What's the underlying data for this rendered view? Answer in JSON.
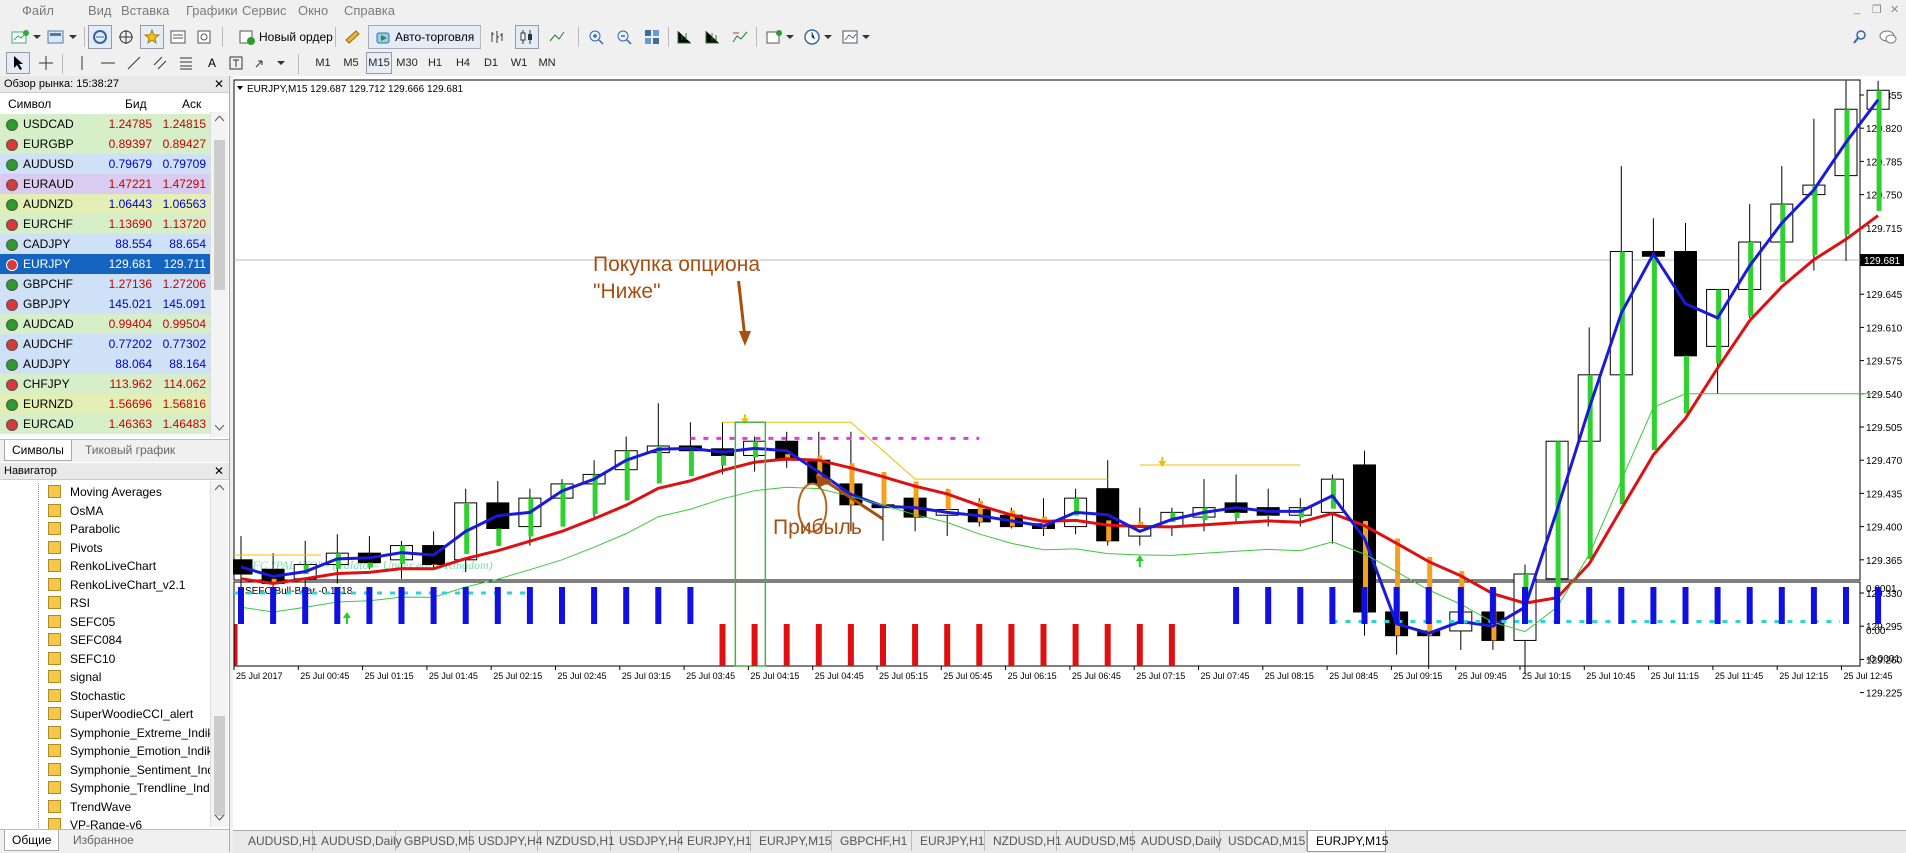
{
  "menu": [
    "Файл",
    "Вид",
    "Вставка",
    "Графики",
    "Сервис",
    "Окно",
    "Справка"
  ],
  "toolbar": {
    "new_order": "Новый ордер",
    "autotrading": "Авто-торговля",
    "timeframes": [
      "M1",
      "M5",
      "M15",
      "M30",
      "H1",
      "H4",
      "D1",
      "W1",
      "MN"
    ],
    "active_timeframe": "M15"
  },
  "market_watch": {
    "title": "Обзор рынка: 15:38:27",
    "col_symbol": "Символ",
    "col_bid": "Бид",
    "col_ask": "Аск",
    "rows": [
      {
        "symbol": "USDCAD",
        "bid": "1.24785",
        "ask": "1.24815",
        "bg": "#d7efc9",
        "color": "#cc0000"
      },
      {
        "symbol": "EURGBP",
        "bid": "0.89397",
        "ask": "0.89427",
        "bg": "#d7efc9",
        "color": "#cc0000"
      },
      {
        "symbol": "AUDUSD",
        "bid": "0.79679",
        "ask": "0.79709",
        "bg": "#cfe1f7",
        "color": "#0000cc"
      },
      {
        "symbol": "EURAUD",
        "bid": "1.47221",
        "ask": "1.47291",
        "bg": "#d9ccf0",
        "color": "#cc0000"
      },
      {
        "symbol": "AUDNZD",
        "bid": "1.06443",
        "ask": "1.06563",
        "bg": "#e3efb5",
        "color": "#0000cc"
      },
      {
        "symbol": "EURCHF",
        "bid": "1.13690",
        "ask": "1.13720",
        "bg": "#d7efc9",
        "color": "#cc0000"
      },
      {
        "symbol": "CADJPY",
        "bid": "88.554",
        "ask": "88.654",
        "bg": "#cfe1f7",
        "color": "#0000cc"
      },
      {
        "symbol": "EURJPY",
        "bid": "129.681",
        "ask": "129.711",
        "bg": "#1565c0",
        "color": "#ffffff"
      },
      {
        "symbol": "GBPCHF",
        "bid": "1.27136",
        "ask": "1.27206",
        "bg": "#cfe1f7",
        "color": "#cc0000"
      },
      {
        "symbol": "GBPJPY",
        "bid": "145.021",
        "ask": "145.091",
        "bg": "#cfe1f7",
        "color": "#0000cc"
      },
      {
        "symbol": "AUDCAD",
        "bid": "0.99404",
        "ask": "0.99504",
        "bg": "#d7efc9",
        "color": "#cc0000"
      },
      {
        "symbol": "AUDCHF",
        "bid": "0.77202",
        "ask": "0.77302",
        "bg": "#cfe1f7",
        "color": "#0000cc"
      },
      {
        "symbol": "AUDJPY",
        "bid": "88.064",
        "ask": "88.164",
        "bg": "#cfe1f7",
        "color": "#0000cc"
      },
      {
        "symbol": "CHFJPY",
        "bid": "113.962",
        "ask": "114.062",
        "bg": "#d7efc9",
        "color": "#cc0000"
      },
      {
        "symbol": "EURNZD",
        "bid": "1.56696",
        "ask": "1.56816",
        "bg": "#e3efb5",
        "color": "#cc0000"
      },
      {
        "symbol": "EURCAD",
        "bid": "1.46363",
        "ask": "1.46483",
        "bg": "#d7efc9",
        "color": "#cc0000"
      }
    ],
    "tabs": [
      "Символы",
      "Тиковый график"
    ]
  },
  "navigator": {
    "title": "Навигатор",
    "items": [
      "Moving Averages",
      "OsMA",
      "Parabolic",
      "Pivots",
      "RenkoLiveChart",
      "RenkoLiveChart_v2.1",
      "RSI",
      "SEFC05",
      "SEFC084",
      "SEFC10",
      "signal",
      "Stochastic",
      "SuperWoodieCCI_alert",
      "Symphonie_Extreme_Indikator",
      "Symphonie_Emotion_Indikator",
      "Symphonie_Sentiment_Indikator",
      "Symphonie_Trendline_Indikator",
      "TrendWave",
      "VP-Range-v6"
    ],
    "tabs": [
      "Общие",
      "Избранное"
    ]
  },
  "chart": {
    "header": "EURJPY,M15  129.687 129.712 129.666 129.681",
    "price_labels": [
      "129.855",
      "129.820",
      "129.785",
      "129.750",
      "129.715",
      "129.681",
      "129.645",
      "129.610",
      "129.575",
      "129.540",
      "129.505",
      "129.470",
      "129.435",
      "129.400",
      "129.365",
      "129.330",
      "129.295",
      "129.260",
      "129.225"
    ],
    "current_price": "129.681",
    "indicator_caption": "SEFC \"PALATO\" - (Palato = Under earth Kingdom)",
    "sub_label": "SEFC Bull-Bear -0.1718",
    "sub_scale": [
      "0.0001",
      "0.00",
      "-0.0001"
    ],
    "time_labels": [
      "25 Jul 2017",
      "25 Jul 00:45",
      "25 Jul 01:15",
      "25 Jul 01:45",
      "25 Jul 02:15",
      "25 Jul 02:45",
      "25 Jul 03:15",
      "25 Jul 03:45",
      "25 Jul 04:15",
      "25 Jul 04:45",
      "25 Jul 05:15",
      "25 Jul 05:45",
      "25 Jul 06:15",
      "25 Jul 06:45",
      "25 Jul 07:15",
      "25 Jul 07:45",
      "25 Jul 08:15",
      "25 Jul 08:45",
      "25 Jul 09:15",
      "25 Jul 09:45",
      "25 Jul 10:15",
      "25 Jul 10:45",
      "25 Jul 11:15",
      "25 Jul 11:45",
      "25 Jul 12:15",
      "25 Jul 12:45"
    ],
    "annotation_buy_line1": "Покупка опциона",
    "annotation_buy_line2": "\"Ниже\"",
    "annotation_profit": "Прибыль"
  },
  "bottom_tabs": [
    "AUDUSD,H1",
    "AUDUSD,Daily",
    "GBPUSD,M5",
    "USDJPY,H4",
    "NZDUSD,H1",
    "USDJPY,H4",
    "EURJPY,H1",
    "EURJPY,M15",
    "GBPCHF,H1",
    "EURJPY,H1",
    "NZDUSD,H1",
    "AUDUSD,M5",
    "AUDUSD,Daily",
    "USDCAD,M15",
    "EURJPY,M15"
  ],
  "active_bottom_tab": 14
}
